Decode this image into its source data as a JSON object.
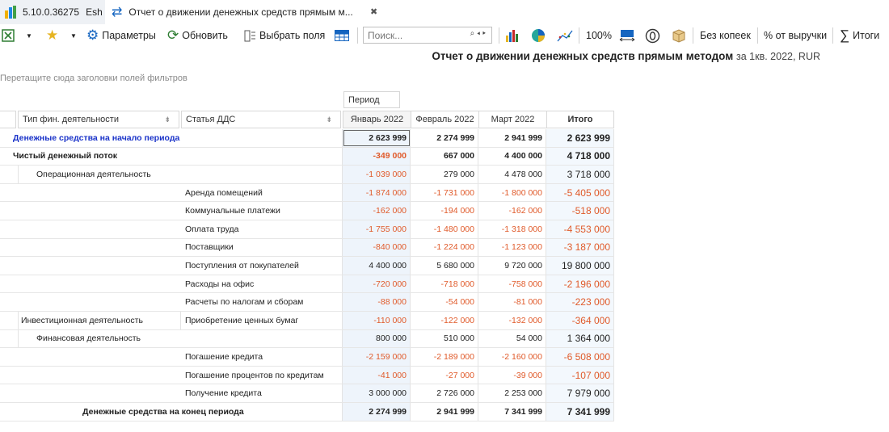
{
  "app": {
    "version": "5.10.0.36275",
    "user": "Esh",
    "tab_title": "Отчет о движении денежных средств прямым м...",
    "close_glyph": "✖"
  },
  "toolbar": {
    "params_label": "Параметры",
    "refresh_label": "Обновить",
    "fields_label": "Выбрать поля",
    "search_placeholder": "Поиск...",
    "zoom": "100%",
    "no_kopecks_label": "Без копеек",
    "percent_revenue_label": "% от выручки",
    "totals_label": "Итоги"
  },
  "report": {
    "title": "Отчет о движении денежных средств прямым методом",
    "subtitle": "за 1кв. 2022, RUR"
  },
  "filter_hint": "Перетащите сюда заголовки полей фильтров",
  "pivot": {
    "period_field": "Период",
    "row_fields": [
      "Тип фин. деятельности",
      "Статья ДДС"
    ],
    "columns": [
      "Январь 2022",
      "Февраль 2022",
      "Март 2022",
      "Итого"
    ],
    "rows": [
      {
        "label": "Денежные средства на начало периода",
        "col": 0,
        "style": "blue",
        "values": [
          "2 623 999",
          "2 274 999",
          "2 941 999",
          "2 623 999"
        ],
        "bold_values": true
      },
      {
        "label": "Чистый денежный поток",
        "col": 0,
        "style": "bold",
        "values": [
          "-349 000",
          "667 000",
          "4 400 000",
          "4 718 000"
        ],
        "bold_values": true
      },
      {
        "label": "Операционная деятельность",
        "col": 1,
        "style": "",
        "values": [
          "-1 039 000",
          "279 000",
          "4 478 000",
          "3 718 000"
        ]
      },
      {
        "label": "Аренда помещений",
        "col": 2,
        "style": "",
        "values": [
          "-1 874 000",
          "-1 731 000",
          "-1 800 000",
          "-5 405 000"
        ]
      },
      {
        "label": "Коммунальные платежи",
        "col": 2,
        "style": "",
        "values": [
          "-162 000",
          "-194 000",
          "-162 000",
          "-518 000"
        ]
      },
      {
        "label": "Оплата труда",
        "col": 2,
        "style": "",
        "values": [
          "-1 755 000",
          "-1 480 000",
          "-1 318 000",
          "-4 553 000"
        ]
      },
      {
        "label": "Поставщики",
        "col": 2,
        "style": "",
        "values": [
          "-840 000",
          "-1 224 000",
          "-1 123 000",
          "-3 187 000"
        ]
      },
      {
        "label": "Поступления от покупателей",
        "col": 2,
        "style": "",
        "values": [
          "4 400 000",
          "5 680 000",
          "9 720 000",
          "19 800 000"
        ]
      },
      {
        "label": "Расходы на офис",
        "col": 2,
        "style": "",
        "values": [
          "-720 000",
          "-718 000",
          "-758 000",
          "-2 196 000"
        ]
      },
      {
        "label": "Расчеты по налогам и сборам",
        "col": 2,
        "style": "",
        "values": [
          "-88 000",
          "-54 000",
          "-81 000",
          "-223 000"
        ]
      },
      {
        "label": "Инвестиционная деятельность",
        "label2": "Приобретение ценных бумаг",
        "col": 1,
        "style": "",
        "values": [
          "-110 000",
          "-122 000",
          "-132 000",
          "-364 000"
        ]
      },
      {
        "label": "Финансовая деятельность",
        "col": 1,
        "style": "",
        "values": [
          "800 000",
          "510 000",
          "54 000",
          "1 364 000"
        ]
      },
      {
        "label": "Погашение кредита",
        "col": 2,
        "style": "",
        "values": [
          "-2 159 000",
          "-2 189 000",
          "-2 160 000",
          "-6 508 000"
        ]
      },
      {
        "label": "Погашение процентов по кредитам",
        "col": 2,
        "style": "",
        "values": [
          "-41 000",
          "-27 000",
          "-39 000",
          "-107 000"
        ]
      },
      {
        "label": "Получение кредита",
        "col": 2,
        "style": "",
        "values": [
          "3 000 000",
          "2 726 000",
          "2 253 000",
          "7 979 000"
        ]
      },
      {
        "label": "Денежные средства на конец периода",
        "col": 3,
        "style": "bold",
        "values": [
          "2 274 999",
          "2 941 999",
          "7 341 999",
          "7 341 999"
        ],
        "bold_values": true
      }
    ]
  },
  "colors": {
    "negative": "#e05a2a",
    "accent_blue": "#1a33c9"
  }
}
